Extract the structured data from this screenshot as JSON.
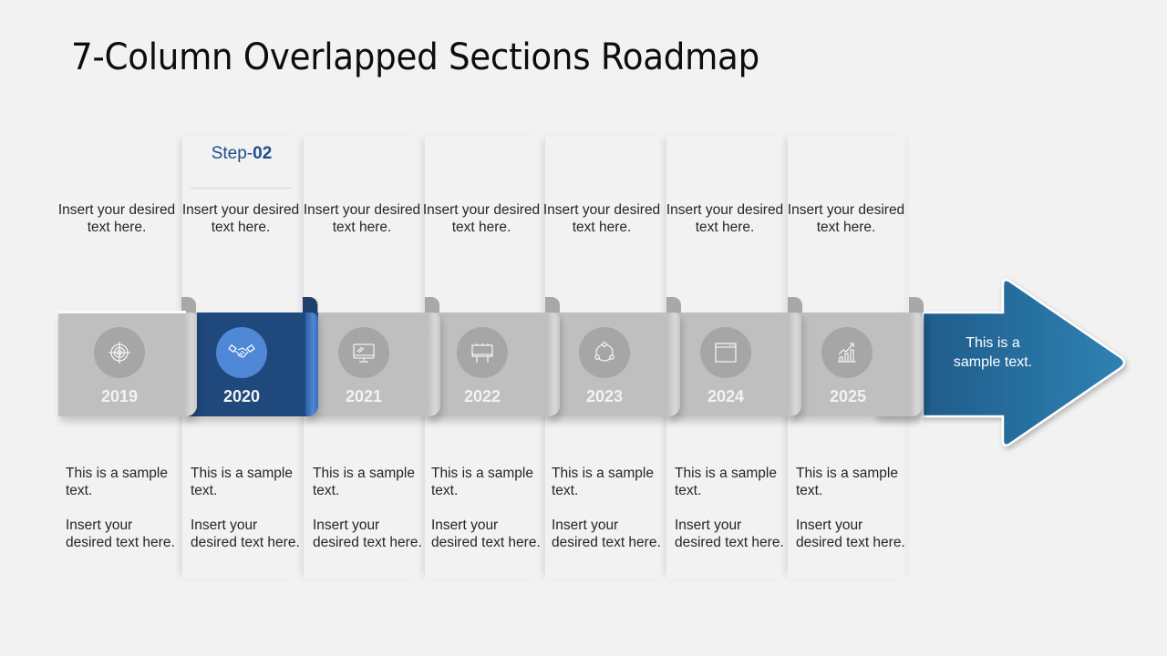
{
  "title": "7-Column Overlapped Sections Roadmap",
  "highlight_color": "#1f497d",
  "accent_color": "#4f88d6",
  "arrow_color": "#2a75a8",
  "step_label": {
    "prefix": "Step-",
    "number": "02"
  },
  "columns": [
    {
      "year": "2019",
      "icon": "target-icon",
      "top_text": "Insert your desired text here.",
      "bottom_line1": "This is a sample text.",
      "bottom_line2": "Insert your desired text here.",
      "active": false
    },
    {
      "year": "2020",
      "icon": "handshake-icon",
      "top_text": "Insert your desired text here.",
      "bottom_line1": "This is a sample text.",
      "bottom_line2": "Insert your desired text here.",
      "active": true
    },
    {
      "year": "2021",
      "icon": "monitor-icon",
      "top_text": "Insert your desired text here.",
      "bottom_line1": "This is a sample text.",
      "bottom_line2": "Insert your desired text here.",
      "active": false
    },
    {
      "year": "2022",
      "icon": "billboard-icon",
      "top_text": "Insert your desired text here.",
      "bottom_line1": "This is a sample text.",
      "bottom_line2": "Insert your desired text here.",
      "active": false
    },
    {
      "year": "2023",
      "icon": "network-cycle-icon",
      "top_text": "Insert your desired text here.",
      "bottom_line1": "This is a sample text.",
      "bottom_line2": "Insert your desired text here.",
      "active": false
    },
    {
      "year": "2024",
      "icon": "browser-window-icon",
      "top_text": "Insert your desired text here.",
      "bottom_line1": "This is a sample text.",
      "bottom_line2": "Insert your desired text here.",
      "active": false
    },
    {
      "year": "2025",
      "icon": "growth-chart-icon",
      "top_text": "Insert your desired text here.",
      "bottom_line1": "This is a sample text.",
      "bottom_line2": "Insert your desired text here.",
      "active": false
    }
  ],
  "arrow_text": "This is a sample text."
}
